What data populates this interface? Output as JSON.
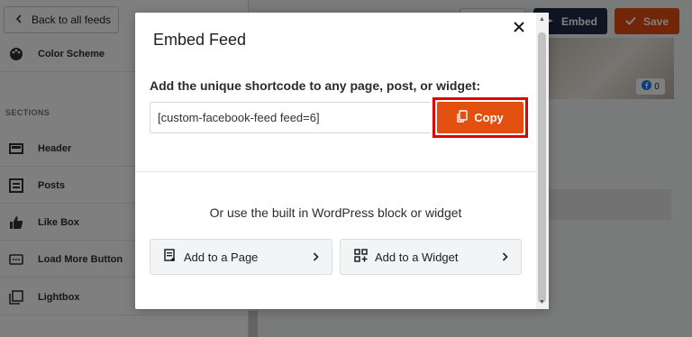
{
  "sidebar": {
    "back_label": "Back to all feeds",
    "color_scheme_label": "Color Scheme",
    "sections_heading": "SECTIONS",
    "items": [
      {
        "label": "Header",
        "icon": "header-icon"
      },
      {
        "label": "Posts",
        "icon": "posts-icon"
      },
      {
        "label": "Like Box",
        "icon": "thumbs-up-icon"
      },
      {
        "label": "Load More Button",
        "icon": "load-more-icon"
      },
      {
        "label": "Lightbox",
        "icon": "lightbox-icon"
      }
    ]
  },
  "topbar": {
    "embed_label": "Embed",
    "save_label": "Save"
  },
  "preview": {
    "facebook_count": "0"
  },
  "modal": {
    "title": "Embed Feed",
    "instructions": "Add the unique shortcode to any page, post, or widget:",
    "shortcode": "[custom-facebook-feed feed=6]",
    "copy_label": "Copy",
    "alt_text": "Or use the built in WordPress block or widget",
    "add_page_label": "Add to a Page",
    "add_widget_label": "Add to a Widget"
  },
  "colors": {
    "accent": "#e34f0f",
    "highlight": "#e00000",
    "embed_button": "#1f2a44"
  }
}
